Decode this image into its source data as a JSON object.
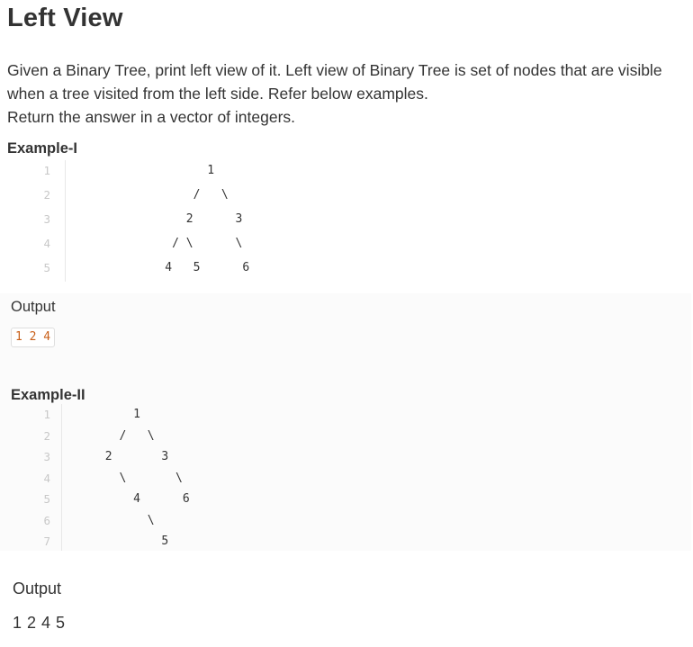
{
  "title": "Left View",
  "description": {
    "line1": "Given a Binary Tree, print left view of it. Left view of Binary Tree is set of nodes that are visible",
    "line2": "when a tree visited from the left side. Refer below examples.",
    "line3": "Return the answer in a vector of integers."
  },
  "example1": {
    "heading": "Example-I",
    "lines": [
      {
        "no": "1",
        "text": "                1"
      },
      {
        "no": "2",
        "text": "              /   \\"
      },
      {
        "no": "3",
        "text": "             2      3"
      },
      {
        "no": "4",
        "text": "           / \\      \\"
      },
      {
        "no": "5",
        "text": "          4   5      6"
      }
    ],
    "output_label": "Output",
    "output_value": "1 2 4"
  },
  "example2": {
    "heading": "Example-II",
    "lines": [
      {
        "no": "1",
        "text": "           1"
      },
      {
        "no": "2",
        "text": "         /   \\"
      },
      {
        "no": "3",
        "text": "       2       3"
      },
      {
        "no": "4",
        "text": "         \\       \\"
      },
      {
        "no": "5",
        "text": "           4      6"
      },
      {
        "no": "6",
        "text": "             \\"
      },
      {
        "no": "7",
        "text": "               5"
      }
    ],
    "output_label": "Output",
    "output_value": "1 2 4 5"
  }
}
